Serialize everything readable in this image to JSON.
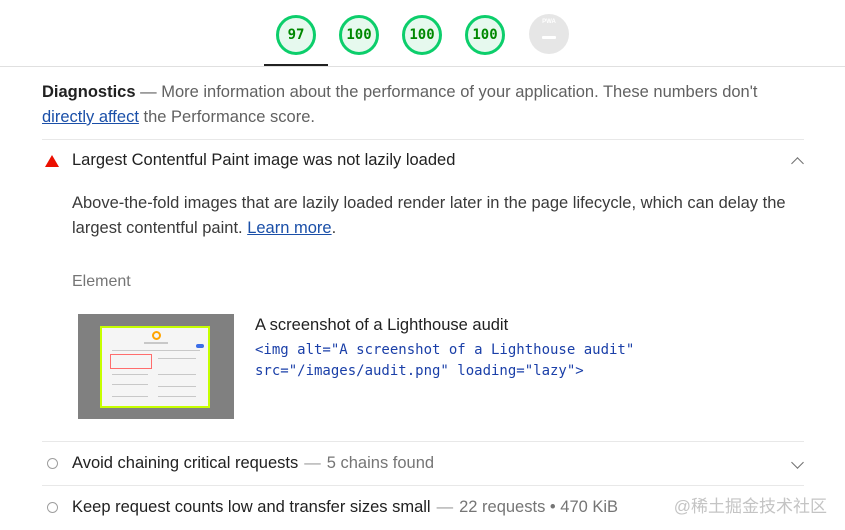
{
  "scores": [
    {
      "label": "97"
    },
    {
      "label": "100"
    },
    {
      "label": "100"
    },
    {
      "label": "100"
    },
    {
      "label": "PWA"
    }
  ],
  "colors": {
    "pass": "#0cce6b",
    "fail": "#eb0f00",
    "link": "#1a4fa8",
    "highlight": "#c6ff00"
  },
  "diagnostics": {
    "title": "Diagnostics",
    "dash": " — ",
    "description": "More information about the performance of your application. These numbers don't",
    "link_text": "directly affect",
    "after_link": " the Performance score."
  },
  "audit_expanded": {
    "icon": "warning-triangle-icon",
    "title": "Largest Contentful Paint image was not lazily loaded",
    "description": "Above-the-fold images that are lazily loaded render later in the page lifecycle, which can delay the largest contentful paint.",
    "link_text": "Learn more",
    "link_suffix": ".",
    "column_header": "Element",
    "element_label": "A screenshot of a Lighthouse audit",
    "element_snippet": "<img alt=\"A screenshot of a Lighthouse audit\"\nsrc=\"/images/audit.png\" loading=\"lazy\">"
  },
  "audits_collapsed": [
    {
      "title": "Avoid chaining critical requests",
      "separator": "—",
      "info": "5 chains found"
    },
    {
      "title": "Keep request counts low and transfer sizes small",
      "separator": "—",
      "info": "22 requests • 470 KiB"
    }
  ],
  "watermark": "@稀土掘金技术社区"
}
